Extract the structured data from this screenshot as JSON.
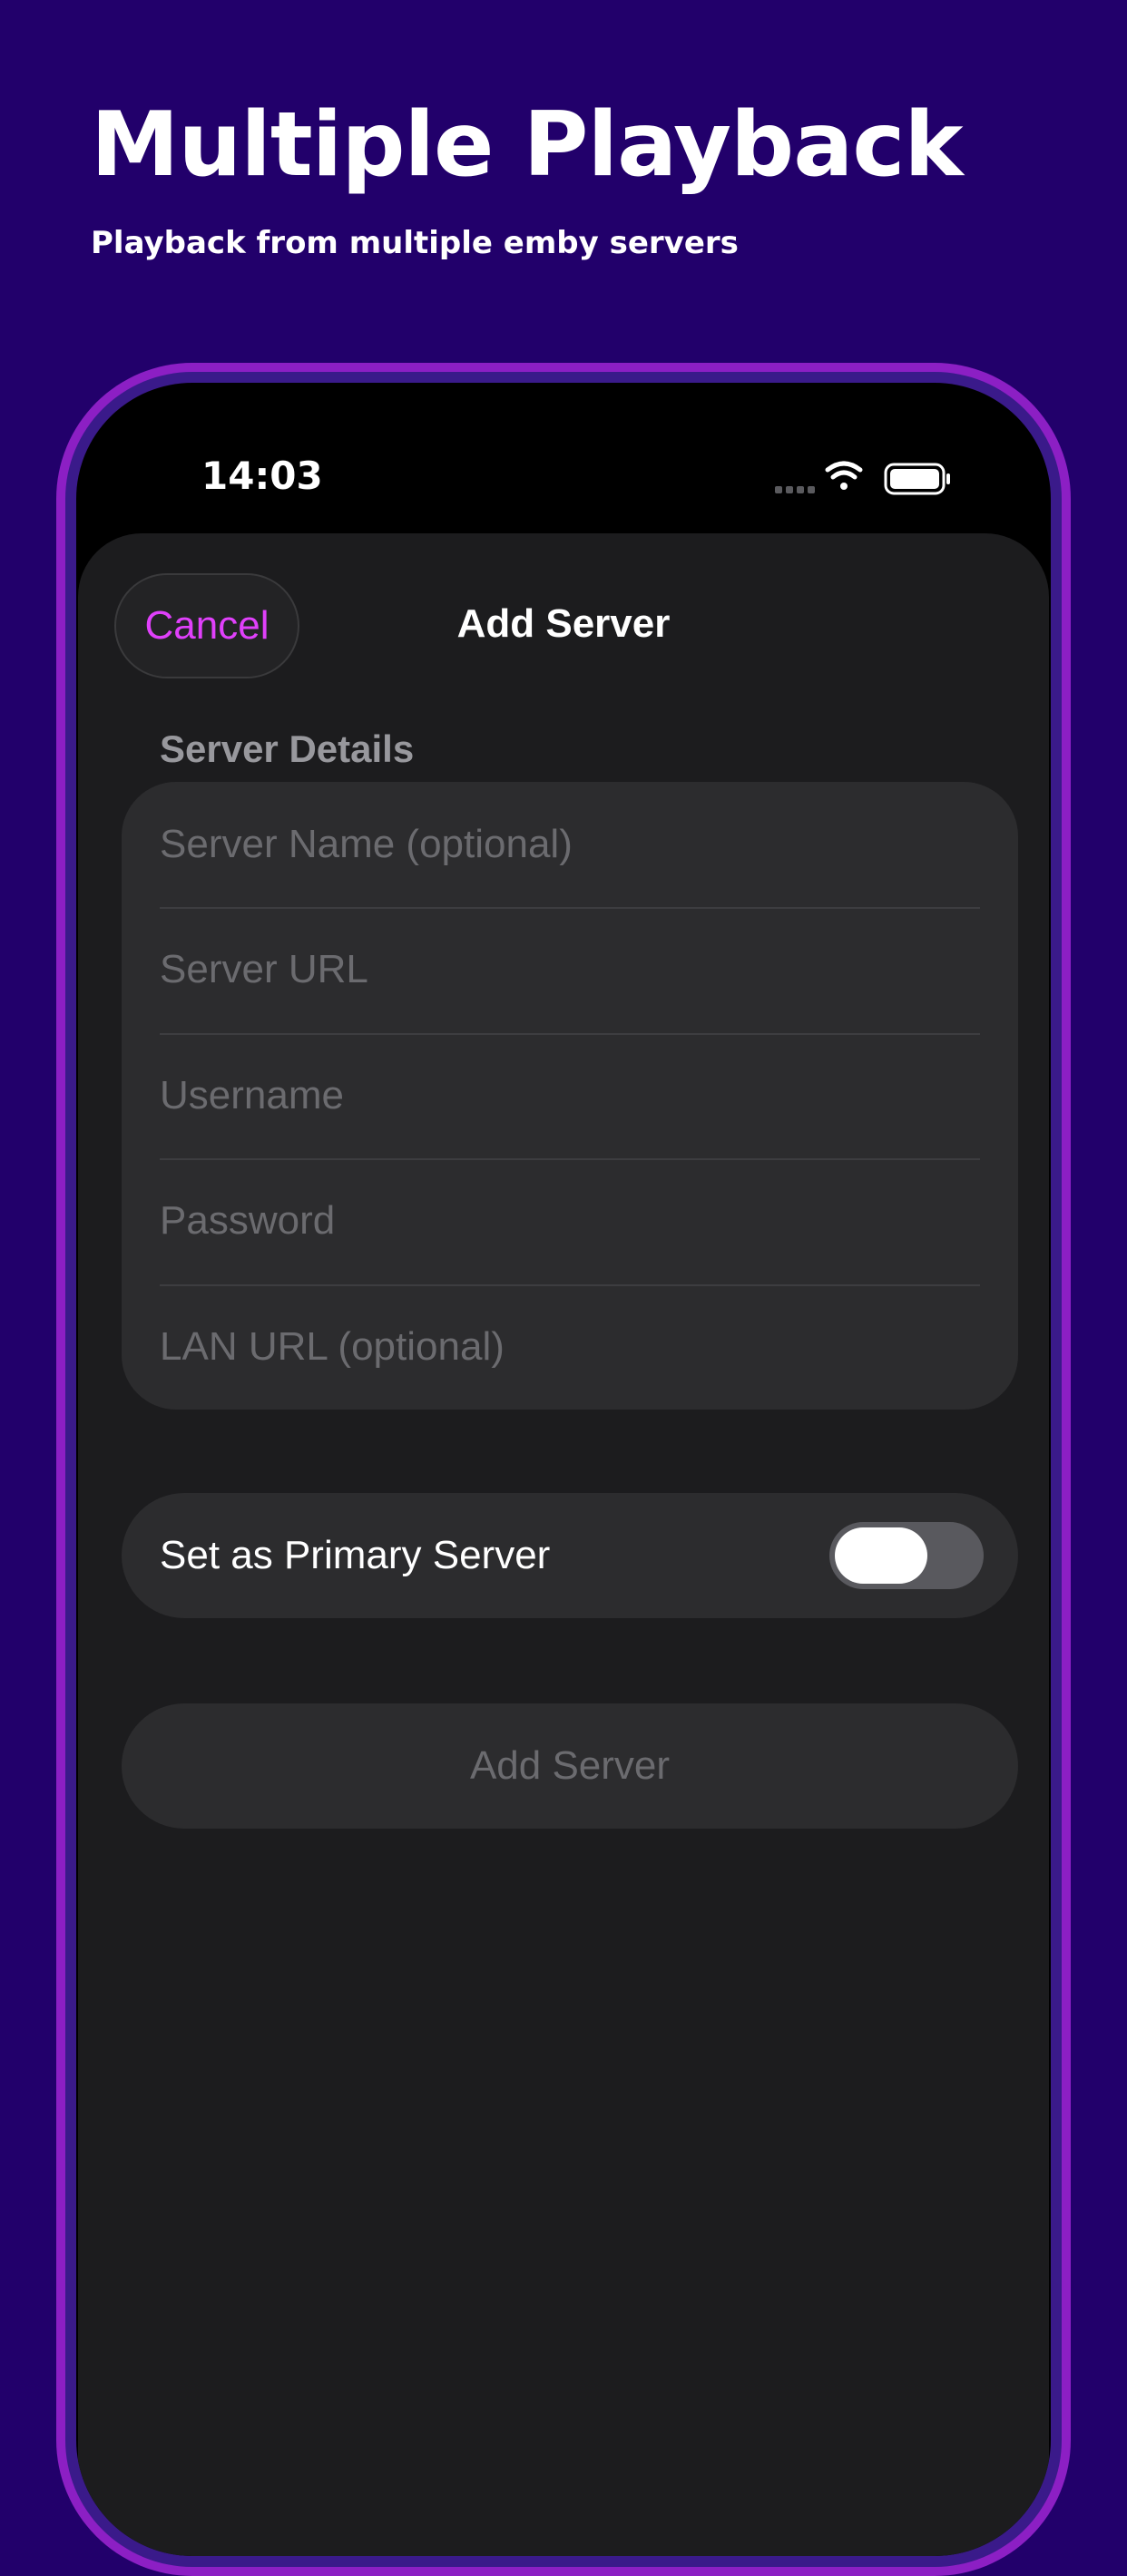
{
  "promo": {
    "headline": "Multiple Playback",
    "subheadline": "Playback from multiple emby servers"
  },
  "status_bar": {
    "time": "14:03",
    "icons": [
      "cellular-signal-icon",
      "wifi-icon",
      "battery-icon"
    ]
  },
  "nav": {
    "cancel_label": "Cancel",
    "title": "Add Server"
  },
  "form": {
    "section_header": "Server Details",
    "fields": [
      {
        "placeholder": "Server Name (optional)",
        "value": ""
      },
      {
        "placeholder": "Server URL",
        "value": ""
      },
      {
        "placeholder": "Username",
        "value": ""
      },
      {
        "placeholder": "Password",
        "value": ""
      },
      {
        "placeholder": "LAN URL (optional)",
        "value": ""
      }
    ],
    "primary_toggle": {
      "label": "Set as Primary Server",
      "on": false
    },
    "submit_label": "Add Server"
  },
  "colors": {
    "background": "#22006b",
    "frame_accent": "#8c1fc4",
    "cancel_accent": "#e040fb",
    "sheet": "#1c1c1e",
    "group": "#2c2c2e"
  }
}
